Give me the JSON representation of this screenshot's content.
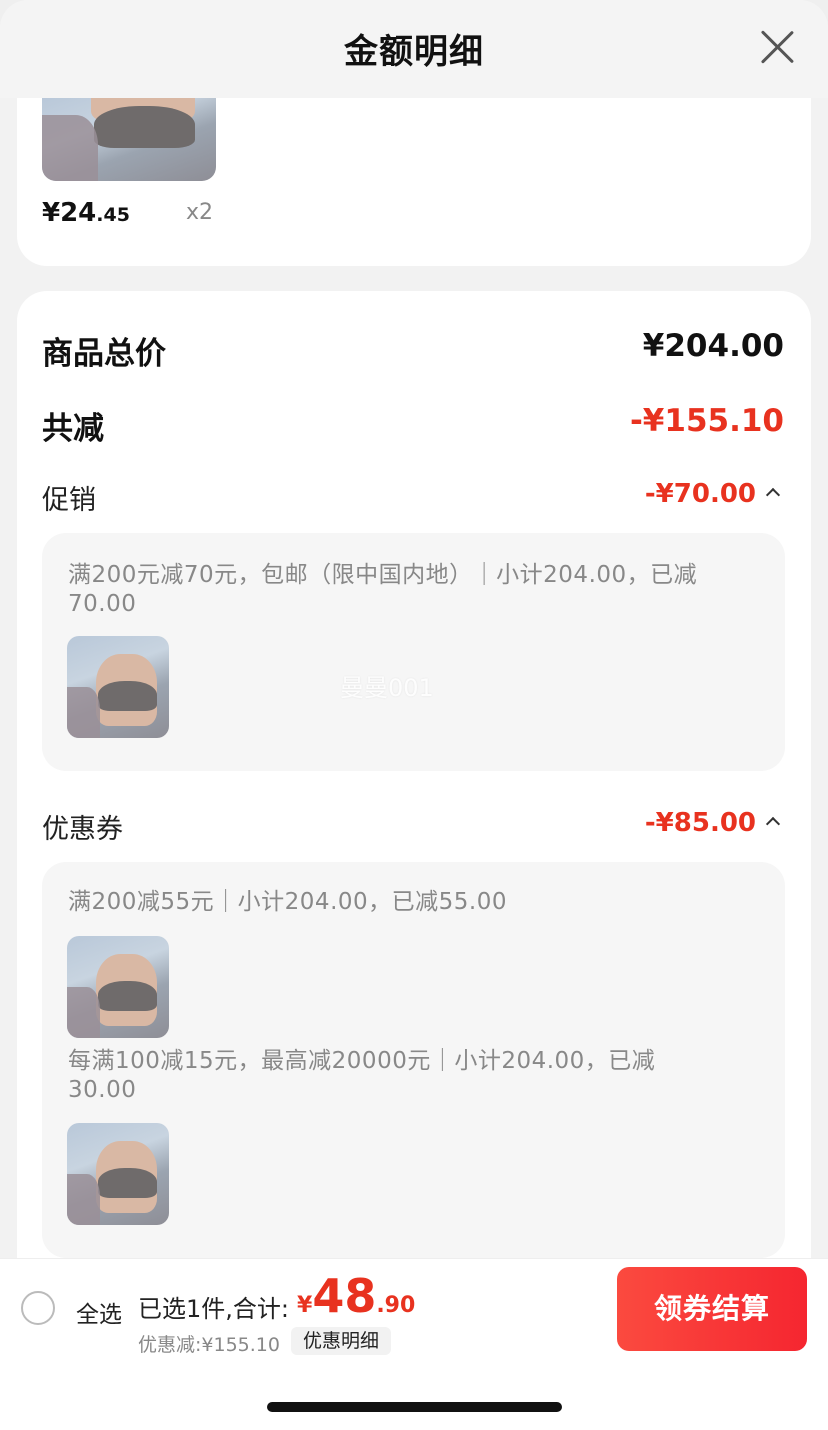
{
  "header": {
    "title": "金额明细"
  },
  "top_item": {
    "price_int": "¥24",
    "price_dec": ".45",
    "qty": "x2"
  },
  "summary": {
    "total_label": "商品总价",
    "total_value": "¥204.00",
    "reduce_label": "共减",
    "reduce_value": "-¥155.10"
  },
  "promotion": {
    "label": "促销",
    "value": "-¥70.00",
    "detail_line1": "满200元减70元，包邮（限中国内地）｜小计204.00，已减",
    "detail_line2": "70.00",
    "watermark": "曼曼001"
  },
  "coupon": {
    "label": "优惠券",
    "value": "-¥85.00",
    "rule1": "满200减55元｜小计204.00，已减55.00",
    "rule2_line1": "每满100减15元，最高减20000元｜小计204.00，已减",
    "rule2_line2": "30.00"
  },
  "footer": {
    "select_all": "全选",
    "selected_text": "已选1件,合计:",
    "total_currency": "¥",
    "total_int": "48",
    "total_dec": ".90",
    "discount_text": "优惠减:¥155.10",
    "detail_button": "优惠明细",
    "checkout_button": "领券结算"
  },
  "colors": {
    "accent_red": "#e8321f",
    "button_red": "#f52630"
  },
  "icons": {
    "close": "close-icon",
    "caret_up": "chevron-up-icon",
    "radio": "radio-unchecked-icon"
  }
}
